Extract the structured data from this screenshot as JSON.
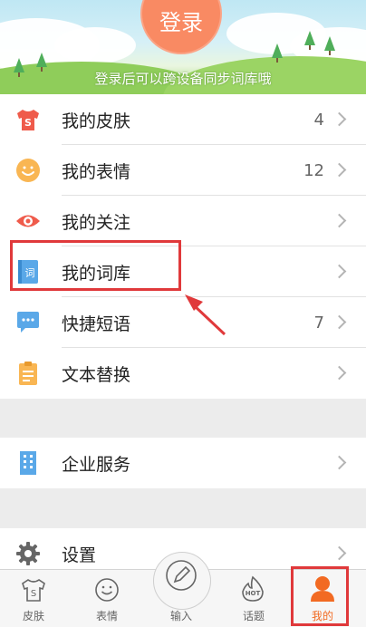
{
  "header": {
    "login_label": "登录",
    "hint": "登录后可以跨设备同步词库哦"
  },
  "menu_group1": [
    {
      "label": "我的皮肤",
      "count": "4",
      "icon": "tshirt-icon"
    },
    {
      "label": "我的表情",
      "count": "12",
      "icon": "smiley-icon"
    },
    {
      "label": "我的关注",
      "count": "",
      "icon": "eye-icon"
    },
    {
      "label": "我的词库",
      "count": "",
      "icon": "dictionary-icon"
    },
    {
      "label": "快捷短语",
      "count": "7",
      "icon": "chat-bubble-icon"
    },
    {
      "label": "文本替换",
      "count": "",
      "icon": "clipboard-icon"
    }
  ],
  "menu_group2": [
    {
      "label": "企业服务",
      "icon": "building-icon"
    }
  ],
  "menu_group3": [
    {
      "label": "设置",
      "icon": "gear-icon"
    }
  ],
  "bottom_nav": [
    {
      "label": "皮肤",
      "icon": "skin-icon"
    },
    {
      "label": "表情",
      "icon": "emoji-icon"
    },
    {
      "label": "输入",
      "icon": "pen-icon"
    },
    {
      "label": "话题",
      "icon": "hot-icon"
    },
    {
      "label": "我的",
      "icon": "user-icon",
      "active": true
    }
  ],
  "colors": {
    "accent": "#f98a63",
    "active": "#f26a22",
    "highlight_box": "#e0393b"
  }
}
